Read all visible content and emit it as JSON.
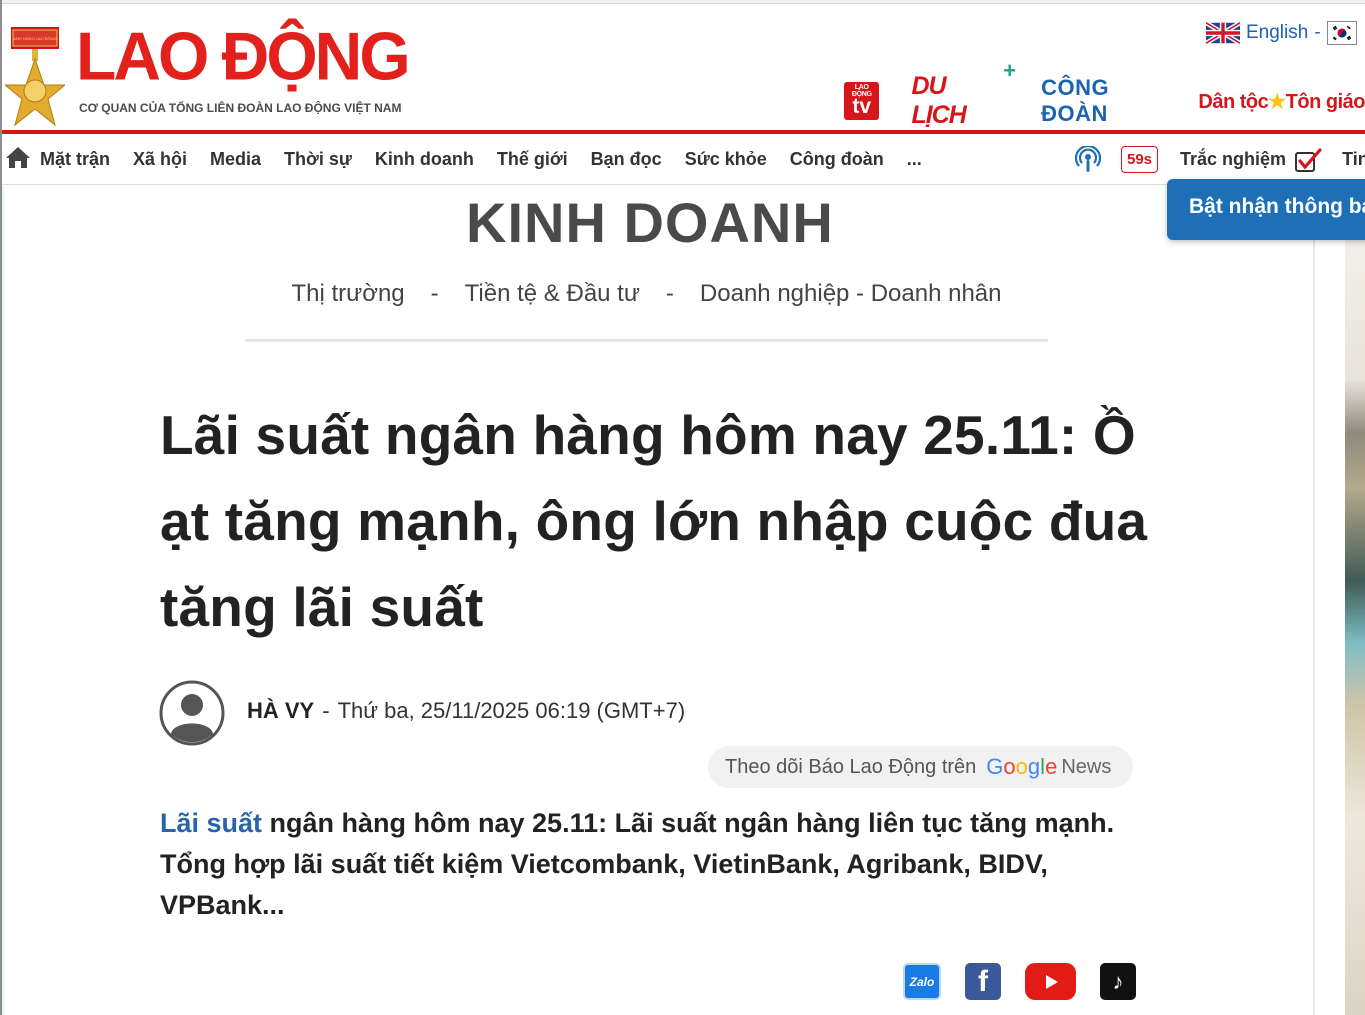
{
  "header": {
    "logo_text": "LAO ĐỘNG",
    "logo_star": "★",
    "tagline": "CƠ QUAN CỦA TỔNG LIÊN ĐOÀN LAO ĐỘNG VIỆT NAM",
    "medal_text": "ANH HÙNG LAO ĐỘNG",
    "language": {
      "label": "English",
      "separator": "-"
    },
    "partners": {
      "tv_small": "LAO ĐỘNG",
      "tv_big": "tv",
      "dulich": "DU LỊCH",
      "dulich_plus": "+",
      "congdoan": "CÔNG ĐOÀN",
      "dantoc_a": "Dân tộc",
      "dantoc_star": "★",
      "dantoc_b": "Tôn giáo"
    }
  },
  "nav": {
    "items": [
      "Mặt trận",
      "Xã hội",
      "Media",
      "Thời sự",
      "Kinh doanh",
      "Thế giới",
      "Bạn đọc",
      "Sức khỏe",
      "Công đoàn",
      "..."
    ],
    "timer": "59s",
    "quiz": "Trắc nghiệm",
    "more_right": "Tin"
  },
  "notify_button": "Bật nhận thông báo",
  "section": {
    "title": "KINH DOANH",
    "subnav": [
      "Thị trường",
      "Tiền tệ & Đầu tư",
      "Doanh nghiệp - Doanh nhân"
    ],
    "separator": "-"
  },
  "article": {
    "headline": "Lãi suất ngân hàng hôm nay 25.11: Ồ ạt tăng mạnh, ông lớn nhập cuộc đua tăng lãi suất",
    "author": "HÀ VY",
    "byline_dash": "-",
    "date": "Thứ ba, 25/11/2025 06:19 (GMT+7)",
    "google_news": {
      "prefix": "Theo dõi Báo Lao Động trên",
      "google": "Google",
      "news": "News"
    },
    "sapo_link": "Lãi suất",
    "sapo_text": " ngân hàng hôm nay 25.11: Lãi suất ngân hàng liên tục tăng mạnh. Tổng hợp lãi suất tiết kiệm Vietcombank, VietinBank, Agribank, BIDV, VPBank..."
  },
  "social": {
    "zalo": "Zalo",
    "facebook": "f",
    "tiktok": "♪"
  },
  "colors": {
    "brand_red": "#d7161b",
    "brand_blue": "#1f6fb6",
    "link_blue": "#2a64a8"
  },
  "icons": [
    "home-icon",
    "podcast-icon",
    "check-icon",
    "uk-flag-icon",
    "kr-flag-icon",
    "avatar-icon",
    "youtube-icon"
  ]
}
